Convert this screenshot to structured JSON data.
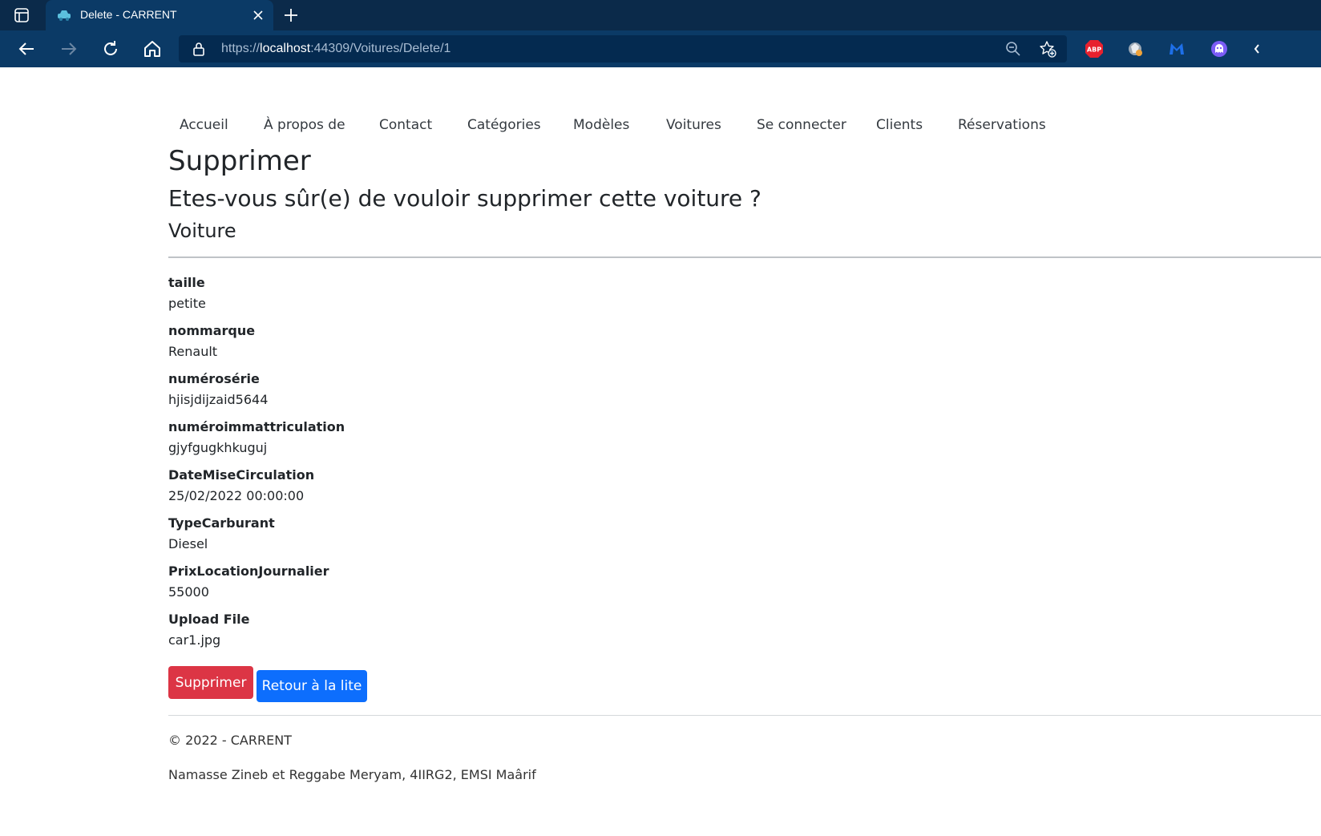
{
  "browser": {
    "tab_title": "Delete - CARRENT",
    "url_scheme": "https://",
    "url_host": "localhost",
    "url_rest": ":44309/Voitures/Delete/1",
    "extensions": [
      "adblock-plus-icon",
      "stylus-extension-icon",
      "malwarebytes-icon",
      "ghost-extension-icon"
    ],
    "extension_abp_label": "ABP",
    "colors": {
      "tabbar": "#0b2a4a",
      "toolbar": "#0b3a66",
      "addressbar": "#042a50"
    }
  },
  "nav": {
    "items": [
      "Accueil",
      "À propos de",
      "Contact",
      "Catégories",
      "Modèles",
      "Voitures",
      "Se connecter",
      "Clients",
      "Réservations"
    ]
  },
  "page": {
    "title": "Supprimer",
    "question": "Etes-vous sûr(e) de vouloir supprimer cette voiture ?",
    "entity": "Voiture"
  },
  "details": [
    {
      "label": "taille",
      "value": "petite"
    },
    {
      "label": "nommarque",
      "value": "Renault"
    },
    {
      "label": "numérosérie",
      "value": "hjisjdijzaid5644"
    },
    {
      "label": "numéroimmattriculation",
      "value": "gjyfgugkhkuguj"
    },
    {
      "label": "DateMiseCirculation",
      "value": "25/02/2022 00:00:00"
    },
    {
      "label": "TypeCarburant",
      "value": "Diesel"
    },
    {
      "label": "PrixLocationJournalier",
      "value": "55000"
    },
    {
      "label": "Upload File",
      "value": "car1.jpg"
    }
  ],
  "actions": {
    "delete_label": "Supprimer",
    "back_label": "Retour à la lite",
    "colors": {
      "danger": "#dc3545",
      "primary": "#0d6efd"
    }
  },
  "footer": {
    "copyright": "© 2022 - CARRENT",
    "authors": "Namasse Zineb et Reggabe Meryam, 4IIRG2, EMSI Maârif"
  }
}
